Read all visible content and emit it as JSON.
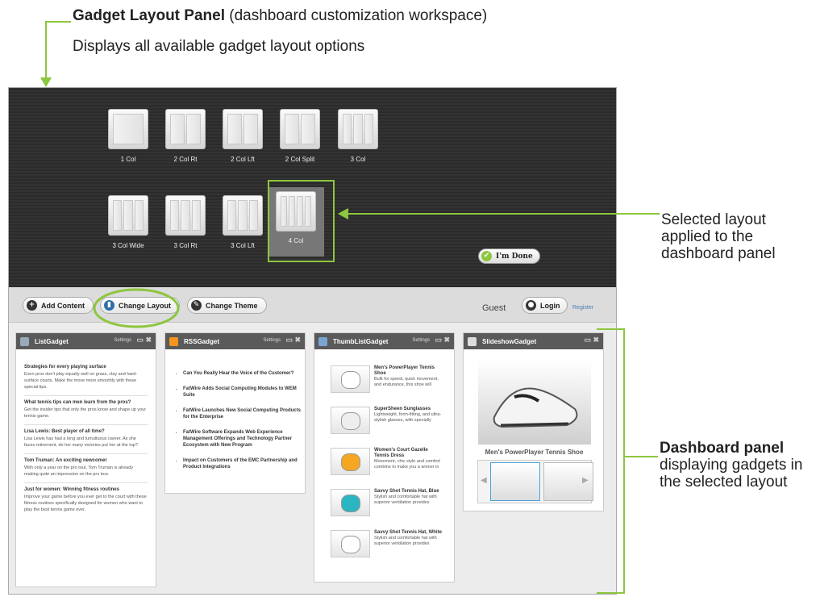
{
  "callouts": {
    "top_title": "Gadget Layout Panel",
    "top_title_rest": "(dashboard customization workspace)",
    "top_desc": "Displays all available gadget layout options",
    "right": "Selected layout applied to the dashboard panel",
    "dash_title": "Dashboard panel",
    "dash_rest": "displaying gadgets in the selected layout"
  },
  "layouts": [
    {
      "label": "1 Col",
      "cols": 1
    },
    {
      "label": "2 Col Rt",
      "cols": 2
    },
    {
      "label": "2 Col Lft",
      "cols": 2
    },
    {
      "label": "2 Col Split",
      "cols": 2
    },
    {
      "label": "3 Col",
      "cols": 3
    },
    {
      "label": "3 Col Wide",
      "cols": 3
    },
    {
      "label": "3 Col Rt",
      "cols": 3
    },
    {
      "label": "3 Col Lft",
      "cols": 3
    },
    {
      "label": "4 Col",
      "cols": 4,
      "selected": true
    }
  ],
  "done_label": "I'm Done",
  "toolbar": {
    "add_content": "Add Content",
    "change_layout": "Change Layout",
    "change_theme": "Change Theme",
    "guest": "Guest",
    "login": "Login",
    "register": "Register"
  },
  "colors": {
    "accent": "#8dc63f",
    "rss": "#f7941d",
    "link": "#4a7fb5"
  },
  "gadgets": {
    "list": {
      "title": "ListGadget",
      "settings": "Settings",
      "items": [
        {
          "title": "Strategies for every playing surface",
          "text": "Even pros don't play equally well on grass, clay and hard-surface courts. Make the move more smoothly with these special tips."
        },
        {
          "title": "What tennis tips can men learn from the pros?",
          "text": "Get the insider tips that only the pros know and shape up your tennis game."
        },
        {
          "title": "Lisa Lewis: Best player of all time?",
          "text": "Lisa Lewis has had a long and tumultuous career. As she faces retirement, do her many victories put her at the top?"
        },
        {
          "title": "Tom Truman: An exciting newcomer",
          "text": "With only a year on the pro tour, Tom Truman is already making quite an impression on the pro tour."
        },
        {
          "title": "Just for women: Winning fitness routines",
          "text": "Improve your game before you ever get to the court with these fitness routines specifically designed for women who want to play the best tennis game ever."
        }
      ]
    },
    "rss": {
      "title": "RSSGadget",
      "settings": "Settings",
      "items": [
        "Can You Really Hear the Voice of the Customer?",
        "FatWire Adds Social Computing Modules to WEM Suite",
        "FatWire Launches New Social Computing Products for the Enterprise",
        "FatWire Software Expands Web Experience Management Offerings and Technology Partner Ecosystem with New Program",
        "Impact on Customers of the EMC Partnership and Product Integrations"
      ]
    },
    "thumb": {
      "title": "ThumbListGadget",
      "settings": "Settings",
      "items": [
        {
          "title": "Men's PowerPlayer Tennis Shoe",
          "text": "Built for speed, quick movement, and endurance, this shoe will"
        },
        {
          "title": "SuperSheen Sunglasses",
          "text": "Lightweight, form-fitting, and ultra-stylish glasses, with specially"
        },
        {
          "title": "Women's Court Gazelle Tennis Dress",
          "text": "Movement, chic style and comfort combine to make you a winner in"
        },
        {
          "title": "Savvy Shot Tennis Hat, Blue",
          "text": "Stylish and comfortable hat with superior ventilation provides"
        },
        {
          "title": "Savvy Shot Tennis Hat, White",
          "text": "Stylish and comfortable hat with superior ventilation provides"
        }
      ]
    },
    "slideshow": {
      "title": "SlideshowGadget",
      "caption": "Men's PowerPlayer Tennis Shoe"
    }
  }
}
